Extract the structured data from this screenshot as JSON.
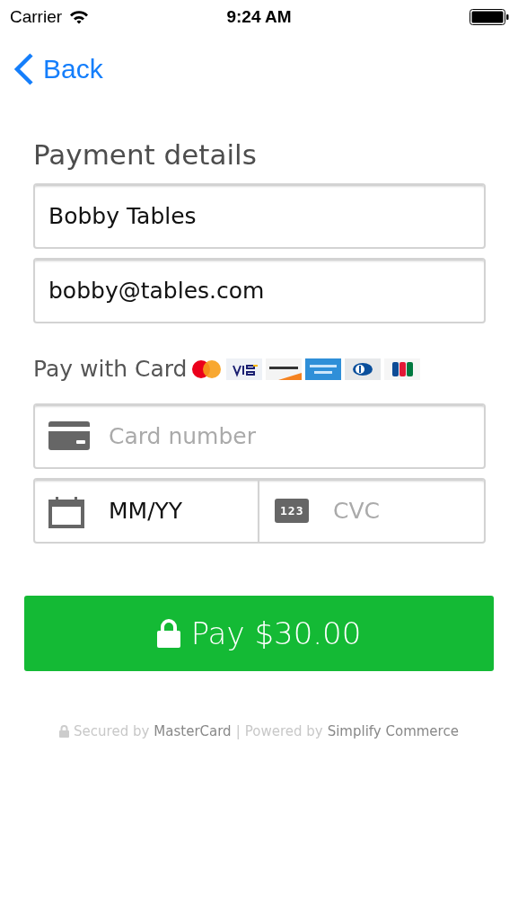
{
  "status_bar": {
    "carrier": "Carrier",
    "time": "9:24 AM"
  },
  "nav": {
    "back": "Back"
  },
  "form": {
    "title": "Payment details",
    "name_field": {
      "value": "Bobby Tables"
    },
    "email_field": {
      "value": "bobby@tables.com"
    },
    "pay_with": "Pay with Card",
    "card_logos": [
      {
        "kind": "mastercard"
      },
      {
        "kind": "visa"
      },
      {
        "kind": "discover"
      },
      {
        "kind": "amex"
      },
      {
        "kind": "diners"
      },
      {
        "kind": "jcb"
      }
    ],
    "card_number": {
      "placeholder": "Card number"
    },
    "expiry": {
      "value": "MM/YY"
    },
    "cvc": {
      "badge": "123",
      "placeholder": "CVC"
    }
  },
  "pay_button": "Pay $30.00",
  "footer": [
    {
      "text": "Secured by",
      "strong": false
    },
    {
      "text": "MasterCard",
      "strong": true
    },
    {
      "text": "|",
      "strong": false
    },
    {
      "text": "Powered by",
      "strong": false
    },
    {
      "text": "Simplify Commerce",
      "strong": true
    }
  ]
}
